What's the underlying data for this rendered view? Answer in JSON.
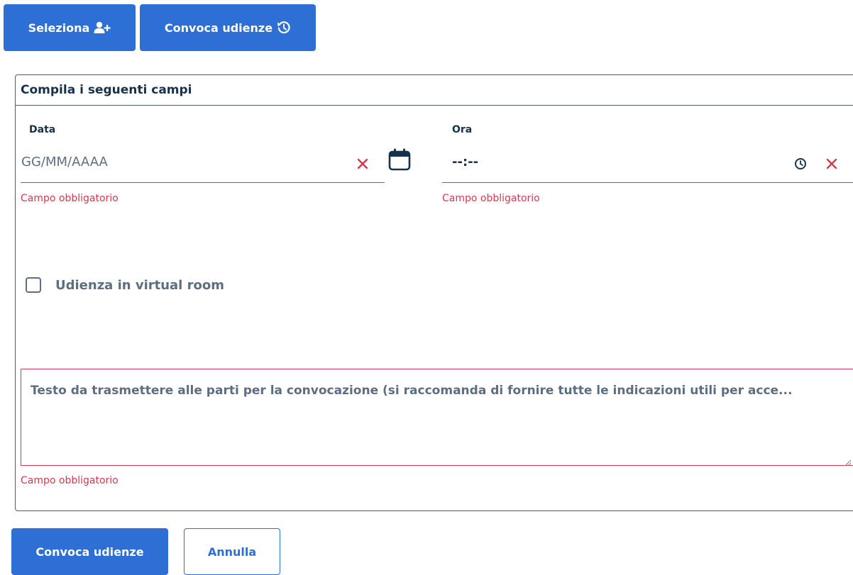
{
  "toolbar": {
    "select_label": "Seleziona",
    "select_icon": "user-plus-icon",
    "convoke_label": "Convoca udienze",
    "convoke_icon": "history-icon"
  },
  "form": {
    "title": "Compila i seguenti campi",
    "date": {
      "label": "Data",
      "placeholder": "GG/MM/AAAA",
      "error": "Campo obbligatorio"
    },
    "time": {
      "label": "Ora",
      "value": "--:--",
      "error": "Campo obbligatorio"
    },
    "virtual_room": {
      "label": "Udienza in virtual room",
      "checked": false
    },
    "message": {
      "placeholder": "Testo da trasmettere alle parti per la convocazione (si raccomanda di fornire tutte le indicazioni utili per acce...",
      "error": "Campo obbligatorio"
    }
  },
  "actions": {
    "submit_label": "Convoca udienze",
    "cancel_label": "Annulla"
  },
  "colors": {
    "primary": "#2e6fd6",
    "error": "#d9364f",
    "heading": "#17324d",
    "text": "#5c6f82"
  }
}
